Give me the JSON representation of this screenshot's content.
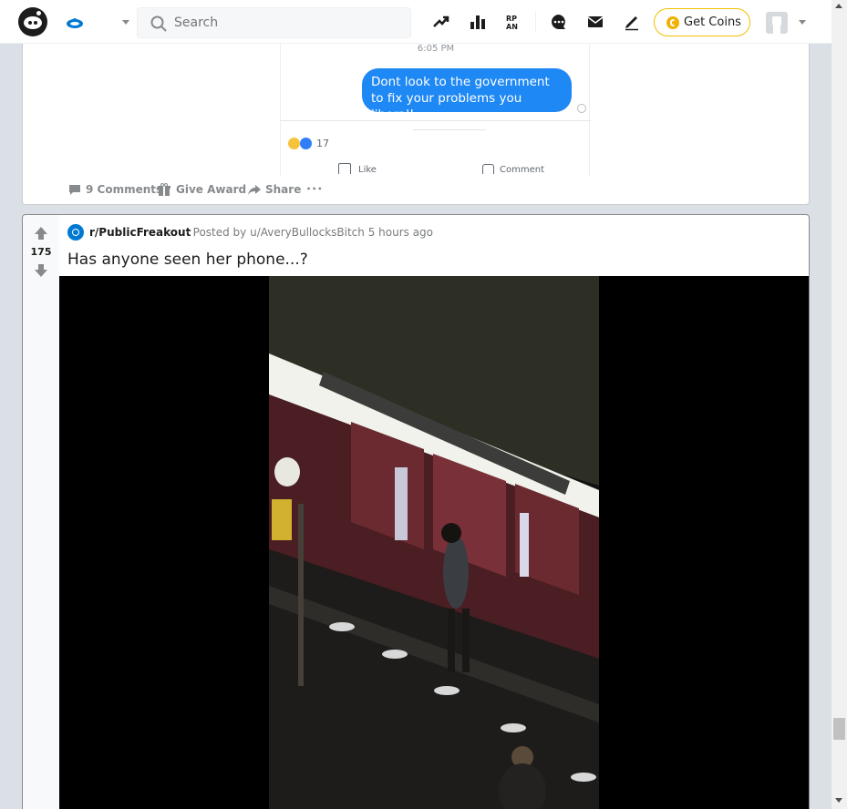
{
  "header": {
    "search_placeholder": "Search",
    "get_coins_label": "Get Coins",
    "icons": [
      "reddit-logo",
      "home-icon",
      "popular-icon",
      "all-icon",
      "rpan-icon",
      "chat-icon",
      "mail-icon",
      "create-post-icon",
      "coins-icon",
      "avatar"
    ]
  },
  "card1": {
    "fb_time": "6:05 PM",
    "fb_message": "Dont look to the government to fix your problems you liberal!",
    "fb_reaction_count": "17",
    "fb_like": "Like",
    "fb_comment": "Comment",
    "comments_label": "9 Comments",
    "award_label": "Give Award",
    "share_label": "Share",
    "more_label": "•••"
  },
  "card2": {
    "vote_count": "175",
    "subreddit": "r/PublicFreakout",
    "posted_by": "· Posted by u/AveryBullocksBitch 5 hours ago",
    "title": "Has anyone seen her phone...?"
  },
  "colors": {
    "accent": "#0079d3",
    "coins": "#f1b100",
    "messenger_blue": "#1e88f4",
    "page_bg": "#dae0e6"
  }
}
